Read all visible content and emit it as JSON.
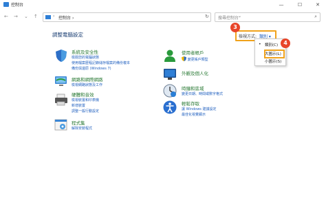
{
  "window": {
    "title": "控制台",
    "minimize": "—",
    "maximize": "☐",
    "close": "✕"
  },
  "nav": {
    "back": "←",
    "forward": "→",
    "dropdown": "⌄",
    "up": "↑"
  },
  "address": {
    "separator": "›",
    "path": "控制台",
    "end_separator": "›",
    "dropdown": "⌄",
    "refresh": "↻"
  },
  "search": {
    "placeholder": "搜尋控制台",
    "icon": "⌕"
  },
  "page_title": "調整電腦設定",
  "view_by": {
    "label": "檢視方式:",
    "value": "類別 ▾"
  },
  "badges": {
    "b3": "3",
    "b4": "4"
  },
  "view_menu": {
    "items": [
      {
        "label": "類別(C)",
        "selected": true
      },
      {
        "label": "大圖示(L)",
        "selected": false
      },
      {
        "label": "小圖示(S)",
        "selected": false
      }
    ],
    "dot": "•"
  },
  "categories_left": [
    {
      "title": "系統及安全性",
      "links": [
        "檢閱您的電腦狀態",
        "使用檔案歷程記錄儲存檔案的備份複本",
        "備份與還原 (Windows 7)"
      ],
      "icon": "shield-icon"
    },
    {
      "title": "網路和網際網路",
      "links": [
        "檢視網路狀態及工作"
      ],
      "icon": "network-icon"
    },
    {
      "title": "硬體和音效",
      "links": [
        "檢視裝置和印表機",
        "新增裝置",
        "調整一般行動設定"
      ],
      "icon": "printer-icon"
    },
    {
      "title": "程式集",
      "links": [
        "解除安裝程式"
      ],
      "icon": "programs-icon"
    }
  ],
  "categories_right": [
    {
      "title": "使用者帳戶",
      "links": [
        "變更帳戶類型"
      ],
      "icon": "user-icon"
    },
    {
      "title": "外觀及個人化",
      "links": [],
      "icon": "appearance-icon"
    },
    {
      "title": "時鐘和區域",
      "links": [
        "變更日期、時間或數字格式"
      ],
      "icon": "clock-icon"
    },
    {
      "title": "輕鬆存取",
      "links": [
        "讓 Windows 建議設定",
        "最佳化視覺顯示"
      ],
      "icon": "accessibility-icon"
    }
  ],
  "colors": {
    "accent": "#1f5fbf",
    "category_title": "#2a7a35",
    "highlight": "#f0a21b",
    "badge": "#e8462a"
  }
}
